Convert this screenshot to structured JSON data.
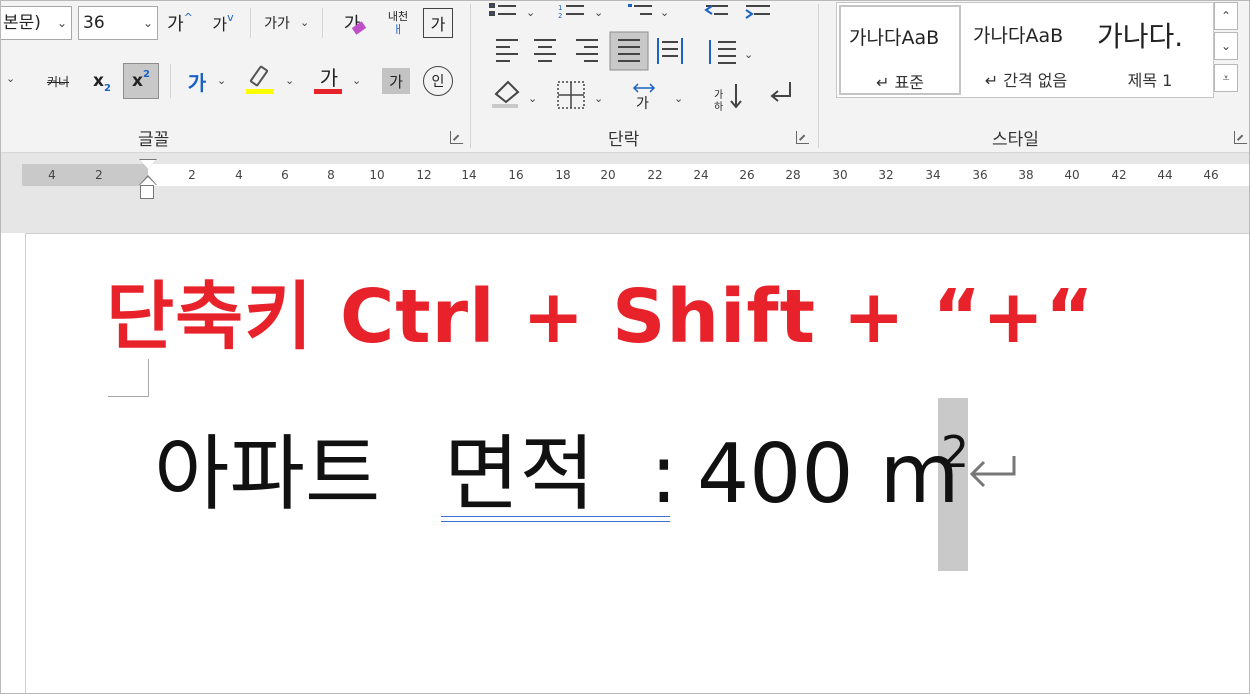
{
  "font": {
    "name_value": "본문)",
    "size_value": "36",
    "grow_label": "가",
    "shrink_label": "가",
    "case_label": "가가",
    "clear_label": "가",
    "phonetic_label": "내천",
    "enclose_label": "가",
    "strike_label": "커너",
    "subscript_label": "x",
    "subscript_mark": "2",
    "superscript_label": "x",
    "superscript_mark": "2",
    "effects_label": "가",
    "highlight_color": "#ffff00",
    "font_color_label": "가",
    "font_color": "#e8222a",
    "shading_label": "가",
    "circle_label": "인",
    "group_label": "글꼴"
  },
  "paragraph": {
    "group_label": "단락",
    "sort_label": "가",
    "sort_sub": "하"
  },
  "styles": {
    "group_label": "스타일",
    "items": [
      {
        "sample": "가나다AaB",
        "name": "↵ 표준"
      },
      {
        "sample": "가나다AaB",
        "name": "↵ 간격 없음"
      },
      {
        "sample": "가나다.",
        "name": "제목 1"
      }
    ]
  },
  "ruler": {
    "ticks": [
      "4",
      "2",
      "2",
      "4",
      "6",
      "8",
      "10",
      "12",
      "14",
      "16",
      "18",
      "20",
      "22",
      "24",
      "26",
      "28",
      "30",
      "32",
      "34",
      "36",
      "38",
      "40",
      "42",
      "44",
      "46"
    ]
  },
  "document": {
    "headline": "단축키 Ctrl + Shift + “+“",
    "line_label": "아파트",
    "line_keyword": "면적",
    "line_colon": ":",
    "line_value": "400 m",
    "line_superscript": "2",
    "accent_color": "#e8222a",
    "underline_color": "#3b6fd1"
  }
}
